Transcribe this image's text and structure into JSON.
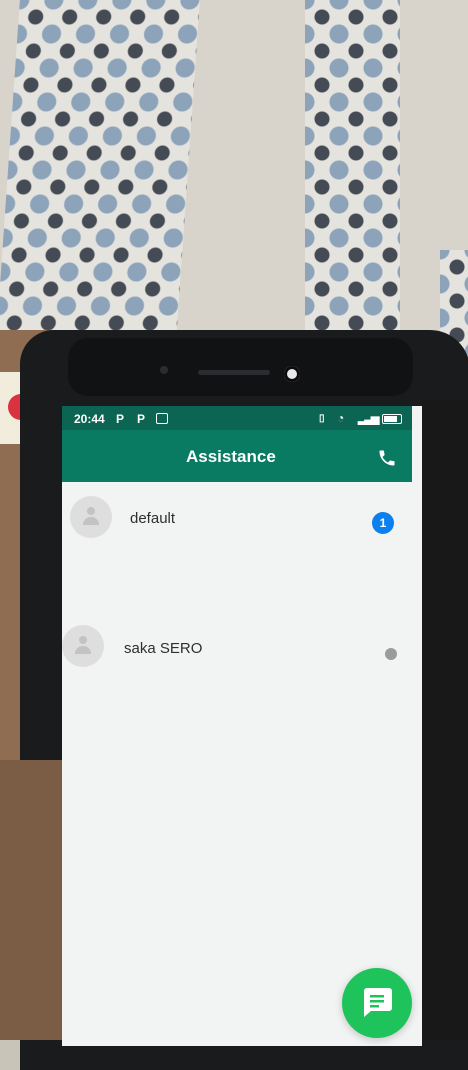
{
  "status_bar": {
    "time": "20:44",
    "notification_p1": "P",
    "notification_p2": "P",
    "message_icon": "message-icon",
    "vibrate_icon": "vibrate-icon",
    "wifi_icon": "wifi-icon",
    "signal_icon": "signal-icon",
    "battery_icon": "battery-icon"
  },
  "app_bar": {
    "title": "Assistance",
    "call_icon": "phone-icon",
    "color": "#0a7b63"
  },
  "conversations": [
    {
      "name": "default",
      "avatar_icon": "person-icon",
      "unread_count": "1",
      "status": "unread",
      "badge_color": "#0b80ee"
    },
    {
      "name": "saka SERO",
      "avatar_icon": "person-icon",
      "status": "read",
      "dot_color": "#9b9b9b"
    }
  ],
  "fab": {
    "icon": "chat-icon",
    "color": "#1fc35b"
  }
}
